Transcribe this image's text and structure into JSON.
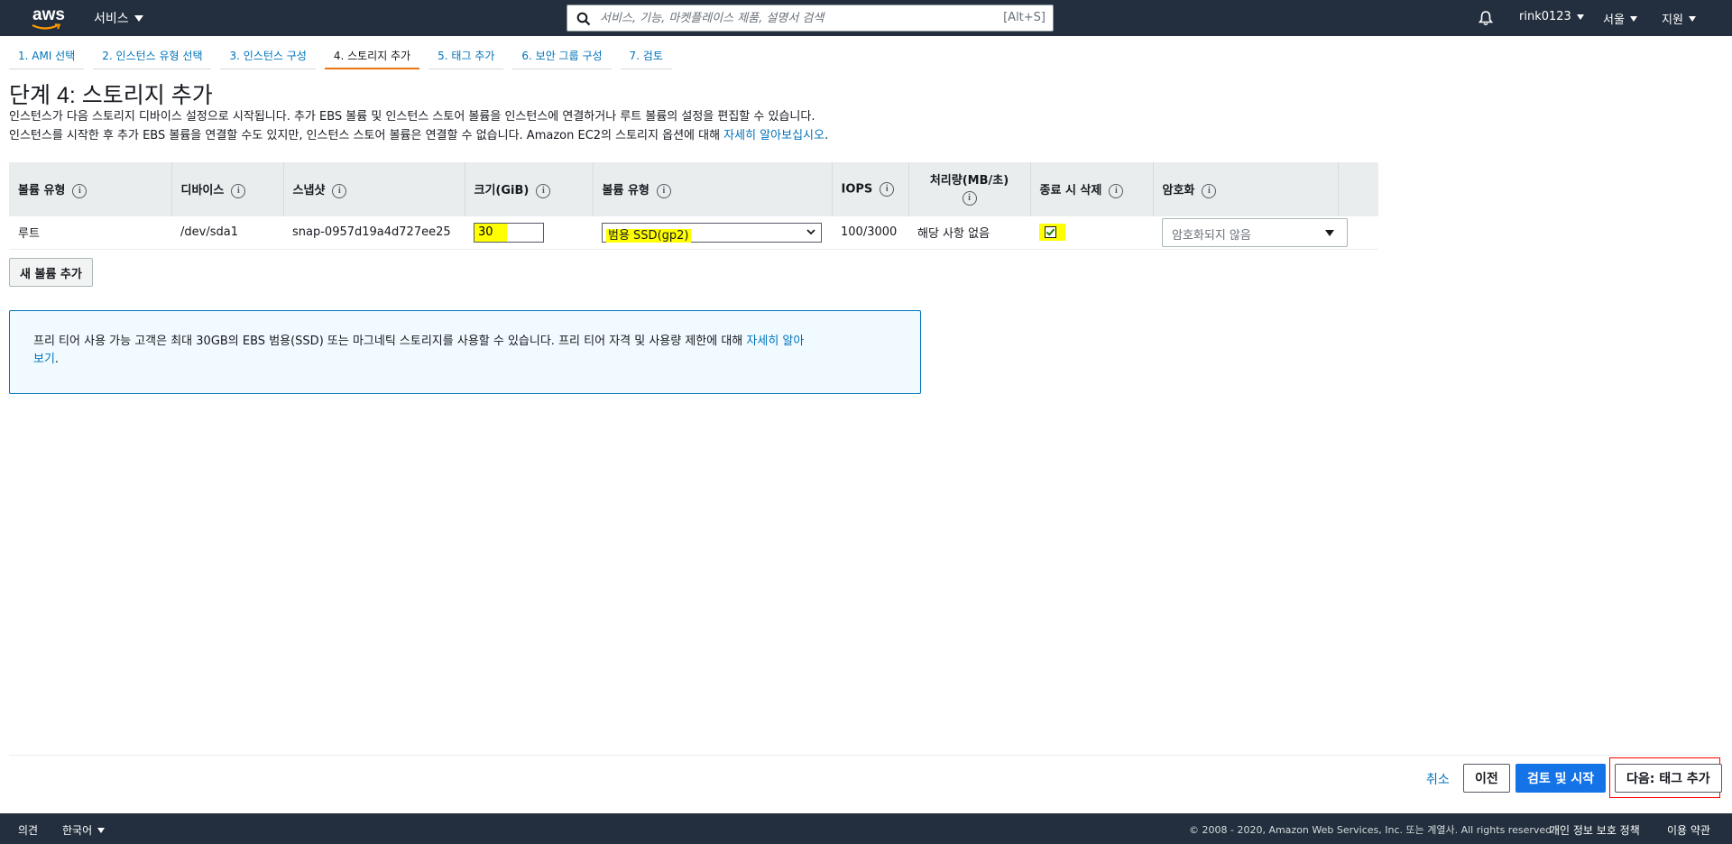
{
  "topnav": {
    "logo_text": "aws",
    "services_label": "서비스",
    "search": {
      "placeholder": "서비스, 기능, 마켓플레이스 제품, 설명서 검색",
      "shortcut": "[Alt+S]"
    },
    "user_label": "rink0123",
    "region_label": "서울",
    "support_label": "지원"
  },
  "wizard": {
    "steps": [
      {
        "label": "1. AMI 선택"
      },
      {
        "label": "2. 인스턴스 유형 선택"
      },
      {
        "label": "3. 인스턴스 구성"
      },
      {
        "label": "4. 스토리지 추가",
        "active": true
      },
      {
        "label": "5. 태그 추가"
      },
      {
        "label": "6. 보안 그룹 구성"
      },
      {
        "label": "7. 검토"
      }
    ]
  },
  "page": {
    "title": "단계 4: 스토리지 추가",
    "desc_line1": "인스턴스가 다음 스토리지 디바이스 설정으로 시작됩니다. 추가 EBS 볼륨 및 인스턴스 스토어 볼륨을 인스턴스에 연결하거나 루트 볼륨의 설정을 편집할 수 있습니다.",
    "desc_line2": "인스턴스를 시작한 후 추가 EBS 볼륨을 연결할 수도 있지만, 인스턴스 스토어 볼륨은 연결할 수 없습니다. Amazon EC2의 스토리지 옵션에 대해 ",
    "desc_link": "자세히 알아보십시오",
    "desc_end": "."
  },
  "table": {
    "headers": {
      "volume_type": "볼륨 유형",
      "device": "디바이스",
      "snapshot": "스냅샷",
      "size": "크기(GiB)",
      "ebs_type": "볼륨 유형",
      "iops": "IOPS",
      "throughput": "처리량(MB/초)",
      "delete_on_termination": "종료 시 삭제",
      "encryption": "암호화"
    },
    "info_glyph": "i",
    "row": {
      "volume_type": "루트",
      "device": "/dev/sda1",
      "snapshot": "snap-0957d19a4d727ee25",
      "size": "30",
      "ebs_type": "범용 SSD(gp2)",
      "iops": "100/3000",
      "throughput": "해당 사항 없음",
      "delete_on_termination": true,
      "encryption": "암호화되지 않음"
    }
  },
  "add_volume_label": "새 볼륨 추가",
  "info_box": {
    "text_line1": "프리 티어 사용 가능 고객은 최대 30GB의 EBS 범용(SSD) 또는 마그네틱 스토리지를 사용할 수 있습니다. 프리 티어 자격 및 사용량 제한에 대해 ",
    "link_part1": "자세히 알아",
    "link_part2": "보기",
    "text_end": "."
  },
  "actions": {
    "cancel_label": "취소",
    "previous_label": "이전",
    "review_launch_label": "검토 및 시작",
    "next_label": "다음: 태그 추가"
  },
  "footer": {
    "feedback_label": "의견",
    "language_label": "한국어",
    "copyright": "© 2008 - 2020, Amazon Web Services, Inc. 또는 계열사. All rights reserved.",
    "privacy_label": "개인 정보 보호 정책",
    "terms_label": "이용 약관"
  },
  "colors": {
    "nav_bg": "#232f3e",
    "link": "#0073bb",
    "primary": "#1473e6",
    "active_tab": "#ec7211",
    "highlight": "#ffff00"
  }
}
